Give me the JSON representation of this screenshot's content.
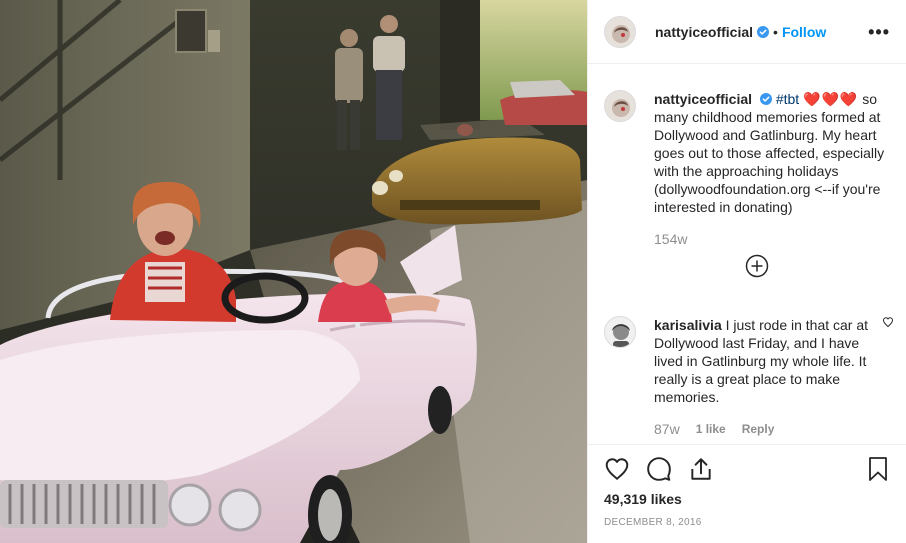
{
  "post": {
    "username": "nattyiceofficial",
    "follow_label": "Follow",
    "separator": "•",
    "more_label": "•••"
  },
  "caption": {
    "username": "nattyiceofficial",
    "hashtag": "#tbt",
    "hearts": "❤️❤️❤️",
    "text": "so many childhood memories formed at Dollywood and Gatlinburg. My heart goes out to those affected, especially with the approaching holidays (dollywoodfoundation.org <--if you're interested in donating)",
    "age": "154w"
  },
  "comment": {
    "username": "karisalivia",
    "text": "I just rode in that car at Dollywood last Friday, and I have lived in Gatlinburg my whole life. It really is a great place to make memories.",
    "age": "87w",
    "likes": "1 like",
    "reply_label": "Reply"
  },
  "footer": {
    "likes": "49,319 likes",
    "date": "December 8, 2016"
  },
  "icons": {
    "verified": "verified-badge-icon",
    "like": "heart-icon",
    "comment": "comment-bubble-icon",
    "share": "share-icon",
    "save": "bookmark-icon",
    "load_more": "plus-circle-icon"
  },
  "colors": {
    "accent": "#0095f6",
    "verified": "#3897f0",
    "muted": "#8e8e8e",
    "heart": "#e0162b"
  }
}
